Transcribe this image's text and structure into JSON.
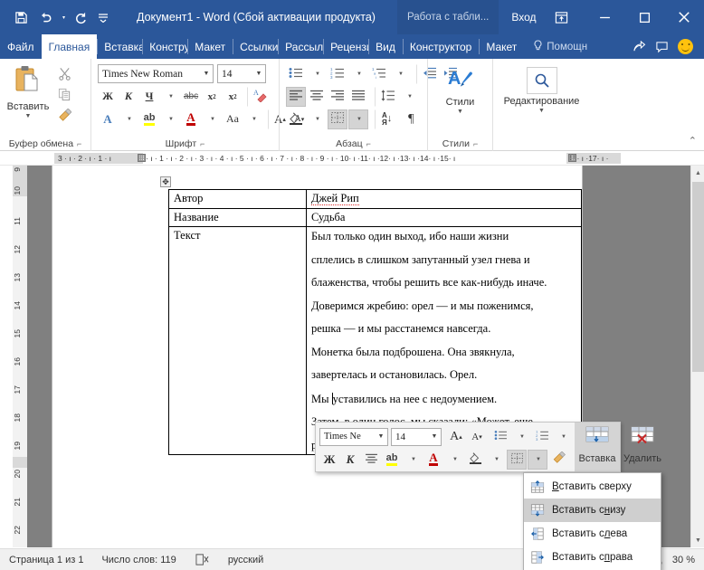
{
  "titlebar": {
    "document_title": "Документ1  -  Word (Сбой активации продукта)",
    "table_tools": "Работа с табли...",
    "signin": "Вход",
    "qat": [
      {
        "name": "save-icon",
        "label": "Сохранить"
      },
      {
        "name": "undo-icon",
        "label": "Отменить"
      },
      {
        "name": "redo-icon",
        "label": "Вернуть"
      },
      {
        "name": "customize-qat-icon",
        "label": "Настройка панели быстрого доступа"
      }
    ],
    "window_buttons": [
      {
        "name": "ribbon-display-options",
        "glyph": "⇱"
      },
      {
        "name": "minimize",
        "glyph": "—"
      },
      {
        "name": "maximize",
        "glyph": "□"
      },
      {
        "name": "close",
        "glyph": "✕"
      }
    ]
  },
  "tabs": [
    {
      "label": "Файл",
      "active": false
    },
    {
      "label": "Главная",
      "active": true
    },
    {
      "label": "Вставка",
      "active": false
    },
    {
      "label": "Констру",
      "active": false
    },
    {
      "label": "Макет",
      "active": false
    },
    {
      "label": "Ссылки",
      "active": false
    },
    {
      "label": "Рассыл",
      "active": false
    },
    {
      "label": "Рецензи",
      "active": false
    },
    {
      "label": "Вид",
      "active": false
    },
    {
      "label": "Конструктор",
      "active": false
    },
    {
      "label": "Макет",
      "active": false
    }
  ],
  "help": {
    "label": "Помощн",
    "icon": "lightbulb-icon"
  },
  "tabstrip_right": {
    "share_icon": "share-icon",
    "comments_icon": "comments-icon",
    "account_icon": "smiley-face-icon"
  },
  "ribbon": {
    "groups": [
      {
        "label": "Буфер обмена",
        "has_launcher": true
      },
      {
        "label": "Шрифт",
        "has_launcher": true
      },
      {
        "label": "Абзац",
        "has_launcher": true
      },
      {
        "label": "Стили",
        "has_launcher": true
      },
      {
        "label": "",
        "has_launcher": false
      }
    ],
    "clipboard": {
      "paste_label": "Вставить",
      "cut_icon": "scissors-icon",
      "copy_icon": "copy-icon",
      "format_painter_icon": "format-painter-icon"
    },
    "font": {
      "font_name": "Times New Roman",
      "font_size": "14",
      "bold": "Ж",
      "italic": "К",
      "underline": "Ч",
      "strikethrough": "abc",
      "subscript": "x",
      "subscript_sub": "2",
      "superscript": "x",
      "superscript_sup": "2",
      "clear_format_icon": "clear-formatting-icon",
      "text_effects": "A",
      "highlight": "ab",
      "font_color": "A",
      "change_case": "Aa",
      "grow_font": "A",
      "shrink_font": "A"
    },
    "paragraph": {
      "bullets_icon": "bullet-list-icon",
      "numbering_icon": "numbered-list-icon",
      "multilevel_icon": "multilevel-list-icon",
      "decrease_indent_icon": "decrease-indent-icon",
      "increase_indent_icon": "increase-indent-icon",
      "align_left_icon": "align-left-icon",
      "align_center_icon": "align-center-icon",
      "align_right_icon": "align-right-icon",
      "justify_icon": "justify-icon",
      "line_spacing_icon": "line-spacing-icon",
      "shading_icon": "shading-icon",
      "borders_icon": "borders-icon",
      "sort_icon": "sort-icon",
      "sort_glyph": "АЯ↓",
      "show_marks_icon": "pilcrow-icon",
      "show_marks_glyph": "¶"
    },
    "styles": {
      "label": "Стили",
      "icon": "styles-icon"
    },
    "editing": {
      "label": "Редактирование",
      "icon": "search-icon"
    },
    "collapse_ribbon_icon": "chevron-up-icon"
  },
  "ruler": {
    "horizontal_left": "3 · ı · 2 · ı · 1 · ı",
    "horizontal_right": "· ı · 1 · ı · 2 · ı · 3 · ı · 4 · ı · 5 · ı · 6 · ı · 7 · ı · 8 · ı · 9 · ı · 10· ı ·11· ı ·12· ı ·13· ı ·14· ı ·15· ı",
    "horizontal_tail": "16· ı ·17· ı ·",
    "vertical": [
      "9",
      "10",
      "11",
      "12",
      "13",
      "14",
      "15",
      "16",
      "17",
      "18",
      "19",
      "20",
      "21",
      "22"
    ]
  },
  "document": {
    "table": [
      {
        "label": "Автор",
        "value": "Джей Рип",
        "misspelled": true,
        "paragraphs": null
      },
      {
        "label": "Название",
        "value": "Судьба",
        "misspelled": false,
        "paragraphs": null
      },
      {
        "label": "Текст",
        "value": null,
        "misspelled": false,
        "paragraphs": [
          "Был только один выход, ибо наши жизни",
          "сплелись в слишком запутанный узел гнева и",
          "блаженства, чтобы решить все как-нибудь иначе.",
          "Доверимся жребию: орел — и мы поженимся,",
          "решка — и мы расстанемся навсегда.",
          "Монетка была подброшена. Она звякнула,",
          "завертелась и остановилась. Орел.",
          "Мы уставились на нее с недоумением.",
          "Затем, в один голос, мы сказали: «Может, еще",
          "разо"
        ]
      }
    ],
    "table_move_handle_icon": "table-move-handle-icon"
  },
  "mini_toolbar": {
    "font_name": "Times Ne",
    "font_size": "14",
    "grow_font": "A",
    "shrink_font": "A",
    "bullets_icon": "bullet-list-icon",
    "numbering_icon": "numbered-list-icon",
    "bold": "Ж",
    "italic": "К",
    "align_icon": "align-center-icon",
    "highlight_icon": "highlight-icon",
    "font_color_icon": "font-color-icon",
    "shading_icon": "shading-icon",
    "borders_icon": "borders-icon",
    "format_painter_icon": "format-painter-icon",
    "insert_label": "Вставка",
    "insert_icon": "insert-table-rows-icon",
    "delete_label": "Удалить",
    "delete_icon": "delete-table-rows-icon"
  },
  "context_menu": {
    "items": [
      {
        "label_before": "",
        "mnemonic": "В",
        "label_after": "ставить сверху",
        "full": "Вставить сверху",
        "icon": "insert-row-above-icon",
        "highlighted": false
      },
      {
        "label_before": "Вставить с",
        "mnemonic": "н",
        "label_after": "изу",
        "full": "Вставить снизу",
        "icon": "insert-row-below-icon",
        "highlighted": true
      },
      {
        "label_before": "Вставить с",
        "mnemonic": "л",
        "label_after": "ева",
        "full": "Вставить слева",
        "icon": "insert-column-left-icon",
        "highlighted": false
      },
      {
        "label_before": "Вставить с",
        "mnemonic": "п",
        "label_after": "рава",
        "full": "Вставить справа",
        "icon": "insert-column-right-icon",
        "highlighted": false
      }
    ]
  },
  "statusbar": {
    "page": "Страница 1 из 1",
    "words": "Число слов: 119",
    "proofing_icon": "proofing-errors-icon",
    "language": "русский",
    "views": [
      {
        "name": "read-mode-icon",
        "active": false
      },
      {
        "name": "print-layout-icon",
        "active": true
      },
      {
        "name": "web-layout-icon",
        "active": false
      }
    ],
    "zoom": "30 %"
  },
  "colors": {
    "word_blue": "#2b579a",
    "tab_tools_blue": "#28518f",
    "accent_red": "#c00000",
    "highlight_yellow": "#ffff00",
    "canvas_gray": "#808080",
    "menu_highlight": "#cfcfcf"
  }
}
